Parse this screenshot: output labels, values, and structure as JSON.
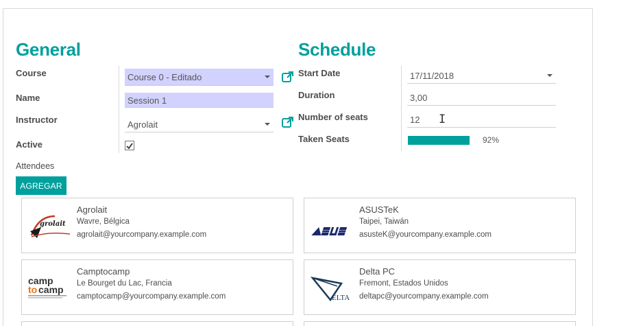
{
  "general": {
    "title": "General",
    "course": {
      "label": "Course",
      "value": "Course 0 - Editado"
    },
    "name": {
      "label": "Name",
      "value": "Session 1"
    },
    "instructor": {
      "label": "Instructor",
      "value": "Agrolait"
    },
    "active": {
      "label": "Active",
      "checked": true
    }
  },
  "schedule": {
    "title": "Schedule",
    "start_date": {
      "label": "Start Date",
      "value": "17/11/2018"
    },
    "duration": {
      "label": "Duration",
      "value": "3,00"
    },
    "seats": {
      "label": "Number of seats",
      "value": "12"
    },
    "taken": {
      "label": "Taken Seats",
      "percent": 92,
      "percent_label": "92%"
    }
  },
  "attendees": {
    "label": "Attendees",
    "add_button": "AGREGAR",
    "cards": [
      {
        "name": "Agrolait",
        "location": "Wavre, Bélgica",
        "email": "agrolait@yourcompany.example.com",
        "logo": "agrolait-logo"
      },
      {
        "name": "ASUSTeK",
        "location": "Taipei, Taiwán",
        "email": "asusteK@yourcompany.example.com",
        "logo": "asus-logo"
      },
      {
        "name": "Camptocamp",
        "location": "Le Bourget du Lac, Francia",
        "email": "camptocamp@yourcompany.example.com",
        "logo": "camptocamp-logo"
      },
      {
        "name": "Delta PC",
        "location": "Fremont, Estados Unidos",
        "email": "deltapc@yourcompany.example.com",
        "logo": "delta-pc-logo"
      }
    ]
  },
  "colors": {
    "accent": "#00A09D",
    "required_field": "#d2d2ff"
  }
}
